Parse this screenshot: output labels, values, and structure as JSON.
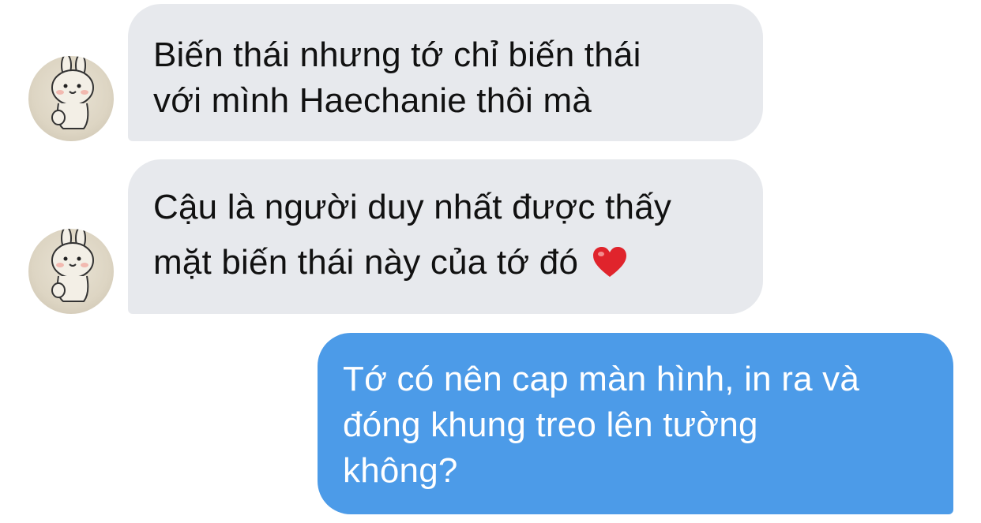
{
  "conversation": {
    "messages": [
      {
        "sender": "them",
        "lines": [
          "Biến thái nhưng tớ chỉ biến thái",
          "với mình Haechanie thôi mà"
        ]
      },
      {
        "sender": "them",
        "lines": [
          "Cậu là người duy nhất được thấy",
          "mặt biến thái này của tớ đó"
        ],
        "emoji": "heart-emoji"
      },
      {
        "sender": "me",
        "lines": [
          "Tớ có nên cap màn hình, in ra và",
          "đóng khung treo lên tường",
          "không?"
        ]
      }
    ]
  },
  "colors": {
    "incoming_bubble": "#e7e9ed",
    "outgoing_bubble": "#4c9be8",
    "heart": "#e0242c"
  },
  "icons": {
    "avatar": "cartoon-bunny-avatar",
    "emoji": "red-heart-emoji"
  }
}
